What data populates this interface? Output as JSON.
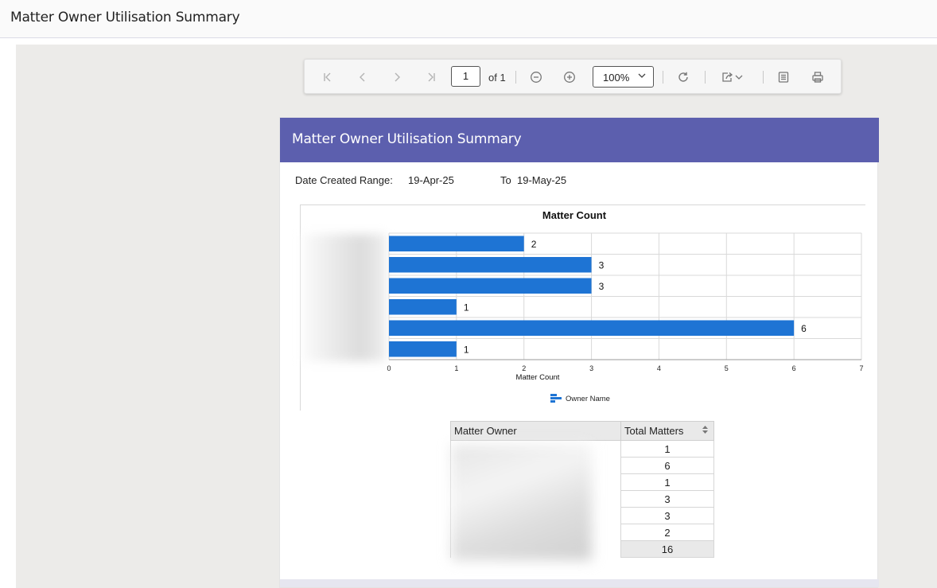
{
  "header": {
    "title": "Matter Owner Utilisation Summary"
  },
  "toolbar": {
    "page_value": "1",
    "of_label": "of 1",
    "zoom_value": "100%",
    "icons": [
      "first-page-icon",
      "previous-page-icon",
      "next-page-icon",
      "last-page-icon",
      "zoom-out-icon",
      "zoom-in-icon",
      "refresh-icon",
      "export-icon",
      "document-map-icon",
      "print-icon"
    ]
  },
  "report": {
    "title": "Matter Owner Utilisation Summary",
    "date_range_label": "Date Created Range:",
    "date_from": "19-Apr-25",
    "to_label": "To",
    "date_to": "19-May-25",
    "banner_color": "#5c5fae"
  },
  "chart_data": {
    "type": "bar",
    "orientation": "horizontal",
    "title": "Matter Count",
    "xlabel": "Matter Count",
    "ylabel": "",
    "categories": [
      "",
      "",
      "",
      "",
      "",
      ""
    ],
    "values": [
      2,
      3,
      3,
      1,
      6,
      1
    ],
    "xlim": [
      0,
      7
    ],
    "xticks": [
      "0",
      "1",
      "2",
      "3",
      "4",
      "5",
      "6",
      "7"
    ],
    "legend": {
      "label": "Owner Name",
      "position": "bottom"
    },
    "bar_color": "#1e74d4",
    "grid": true
  },
  "table": {
    "columns": [
      "Matter Owner",
      "Total Matters"
    ],
    "rows": [
      {
        "owner": "",
        "total": "1"
      },
      {
        "owner": "",
        "total": "6"
      },
      {
        "owner": "",
        "total": "1"
      },
      {
        "owner": "",
        "total": "3"
      },
      {
        "owner": "",
        "total": "3"
      },
      {
        "owner": "",
        "total": "2"
      }
    ],
    "grand_total": "16"
  }
}
